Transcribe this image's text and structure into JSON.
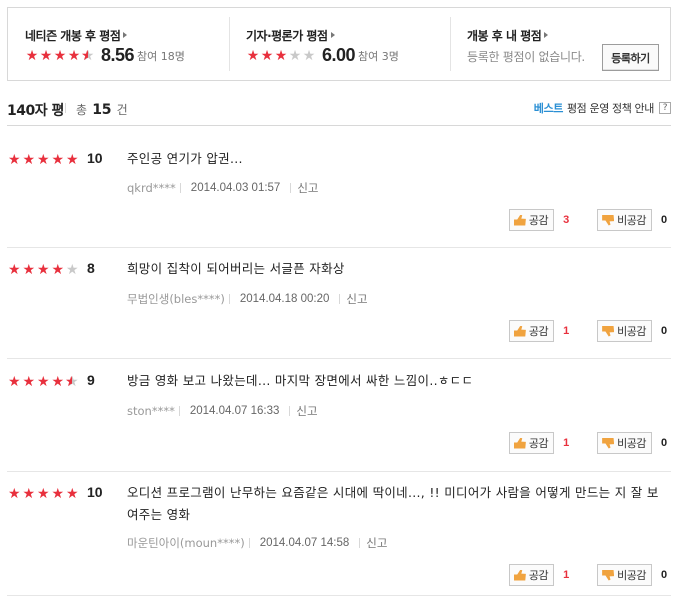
{
  "summary": {
    "netizen": {
      "title": "네티즌 개봉 후 평점",
      "score": "8.56",
      "participants": "참여 18명",
      "stars": 4.5
    },
    "critic": {
      "title": "기자·평론가 평점",
      "score": "6.00",
      "participants": "참여 3명",
      "stars": 3
    },
    "mine": {
      "title": "개봉 후 내 평점",
      "desc": "등록한 평점이 없습니다.",
      "button": "등록하기"
    }
  },
  "header": {
    "title": "140자 평",
    "total_prefix": "총",
    "total_count": "15",
    "total_suffix": "건",
    "best": "베스트",
    "policy": "평점 운영 정책 안내",
    "help": "?"
  },
  "vote_labels": {
    "up": "공감",
    "down": "비공감"
  },
  "reviews": [
    {
      "score": "10",
      "stars": 5,
      "text": "주인공 연기가 압권...",
      "author": "qkrd****",
      "date": "2014.04.03 01:57",
      "report": "신고",
      "up": "3",
      "down": "0"
    },
    {
      "score": "8",
      "stars": 4,
      "text": "희망이 집착이 되어버리는 서글픈 자화상",
      "author": "무법인생(bles****)",
      "date": "2014.04.18 00:20",
      "report": "신고",
      "up": "1",
      "down": "0"
    },
    {
      "score": "9",
      "stars": 4.5,
      "text": "방금 영화 보고 나왔는데... 마지막 장면에서 싸한 느낌이..ㅎㄷㄷ",
      "author": "ston****",
      "date": "2014.04.07 16:33",
      "report": "신고",
      "up": "1",
      "down": "0"
    },
    {
      "score": "10",
      "stars": 5,
      "text": "오디션 프로그램이 난무하는 요즘같은 시대에 딱이네..., !! 미디어가 사람을 어떻게 만드는 지 잘 보여주는 영화",
      "author": "마운틴아이(moun****)",
      "date": "2014.04.07 14:58",
      "report": "신고",
      "up": "1",
      "down": "0"
    }
  ],
  "colors": {
    "star_on": "#e8303d",
    "star_off": "#c9c9c9",
    "best": "#2a8fd4",
    "up_count": "#e8303d"
  }
}
